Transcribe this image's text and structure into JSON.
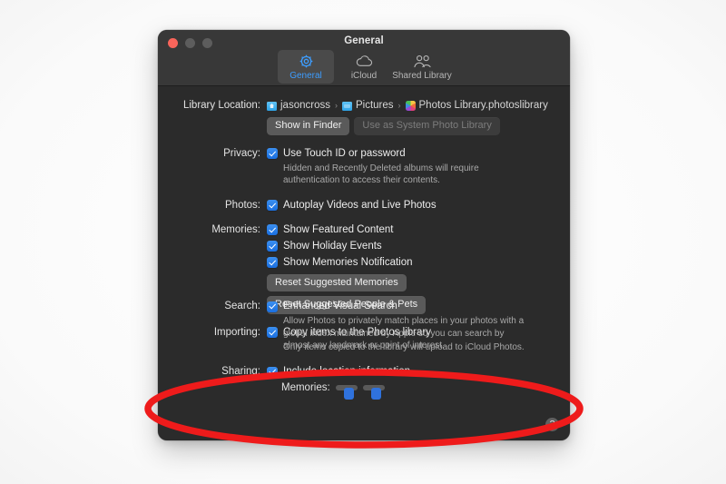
{
  "window": {
    "title": "General",
    "traffic_lights": [
      "close",
      "minimize",
      "zoom"
    ]
  },
  "toolbar": {
    "tabs": [
      {
        "label": "General",
        "icon": "gear-icon",
        "selected": true
      },
      {
        "label": "iCloud",
        "icon": "cloud-icon",
        "selected": false
      },
      {
        "label": "Shared Library",
        "icon": "people-icon",
        "selected": false
      }
    ]
  },
  "sections": {
    "library_location": {
      "label": "Library Location:",
      "breadcrumb": [
        {
          "text": "jasoncross",
          "icon": "home-folder-icon"
        },
        {
          "text": "Pictures",
          "icon": "folder-icon"
        },
        {
          "text": "Photos Library.photoslibrary",
          "icon": "photos-app-icon"
        }
      ],
      "separator": "›",
      "buttons": [
        {
          "label": "Show in Finder",
          "enabled": true
        },
        {
          "label": "Use as System Photo Library",
          "enabled": false
        }
      ]
    },
    "privacy": {
      "label": "Privacy:",
      "checkbox_label": "Use Touch ID or password",
      "checked": true,
      "help": "Hidden and Recently Deleted albums will require authentication to access their contents."
    },
    "photos": {
      "label": "Photos:",
      "checkbox_label": "Autoplay Videos and Live Photos",
      "checked": true
    },
    "memories": {
      "label": "Memories:",
      "checkboxes": [
        {
          "label": "Show Featured Content",
          "checked": true
        },
        {
          "label": "Show Holiday Events",
          "checked": true
        },
        {
          "label": "Show Memories Notification",
          "checked": true
        }
      ],
      "buttons": [
        {
          "label": "Reset Suggested Memories",
          "enabled": true
        },
        {
          "label": "Reset Suggested People & Pets",
          "enabled": true
        }
      ]
    },
    "importing": {
      "label": "Importing:",
      "checkbox_label": "Copy items to the Photos library",
      "checked": true,
      "help": "Only items copied to the library will upload to iCloud Photos."
    },
    "sharing": {
      "label": "Sharing:",
      "checkbox_label": "Include location information",
      "checked": true,
      "sub_label": "Memories:",
      "sub_note": "obscured-by-annotation"
    },
    "search": {
      "label": "Search:",
      "checkbox_label": "Enhanced Visual Search",
      "checked": true,
      "help": "Allow Photos to privately match places in your photos with a global index maintained by Apple so you can search by almost any landmark or point of interest."
    }
  },
  "help_button": {
    "glyph": "?"
  },
  "annotation": {
    "shape": "ellipse",
    "color": "#ee1b1b",
    "highlights": "search-section"
  },
  "colors": {
    "accent": "#3d9dff",
    "checkbox": "#2f79e6",
    "window_bg": "#2b2b2b",
    "titlebar_bg": "#383838",
    "annotation": "#ee1b1b"
  }
}
